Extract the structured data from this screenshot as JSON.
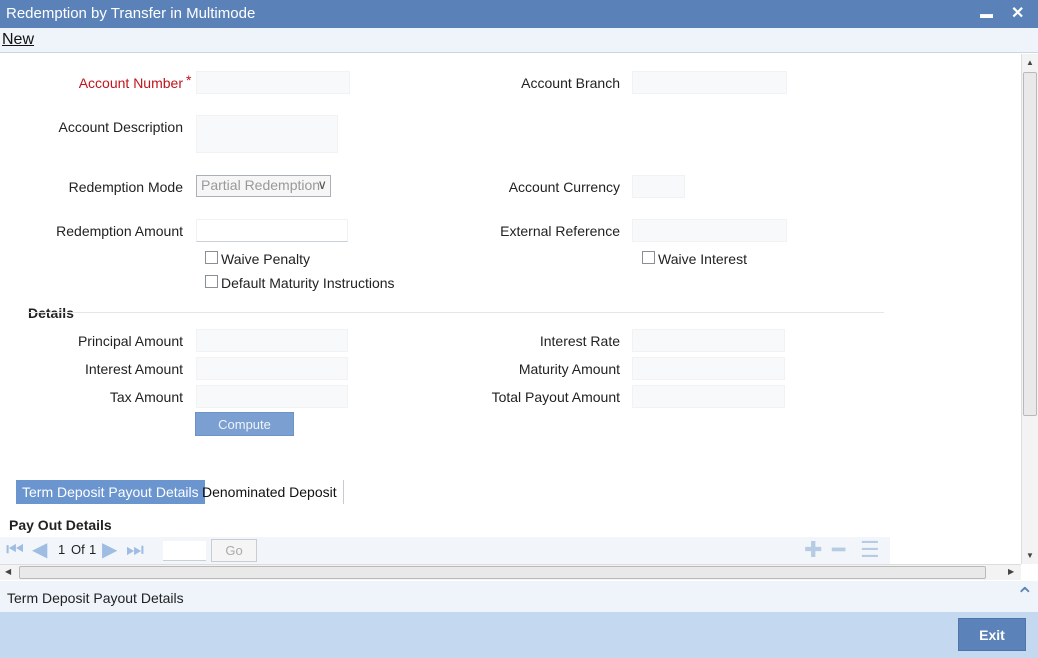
{
  "window": {
    "title": "Redemption by Transfer in Multimode",
    "minimize_glyph": "▬",
    "close_glyph": "✕"
  },
  "menu": {
    "new_label": "New"
  },
  "form": {
    "account_number_label": "Account Number",
    "required_marker": "*",
    "account_number_value": "",
    "account_branch_label": "Account Branch",
    "account_branch_value": "",
    "account_description_label": "Account Description",
    "account_description_value": "",
    "redemption_mode_label": "Redemption Mode",
    "redemption_mode_value": "Partial Redemption",
    "account_currency_label": "Account Currency",
    "account_currency_value": "",
    "redemption_amount_label": "Redemption Amount",
    "redemption_amount_value": "",
    "external_reference_label": "External Reference",
    "external_reference_value": "",
    "waive_penalty_label": "Waive Penalty",
    "waive_penalty_checked": false,
    "default_maturity_label": "Default Maturity Instructions",
    "default_maturity_checked": false,
    "waive_interest_label": "Waive Interest",
    "waive_interest_checked": false
  },
  "details": {
    "section_title": "Details",
    "principal_amount_label": "Principal Amount",
    "interest_amount_label": "Interest Amount",
    "tax_amount_label": "Tax Amount",
    "interest_rate_label": "Interest Rate",
    "maturity_amount_label": "Maturity Amount",
    "total_payout_amount_label": "Total Payout Amount",
    "compute_label": "Compute"
  },
  "tabs": [
    {
      "label": "Term Deposit Payout Details",
      "active": true
    },
    {
      "label": "Denominated Deposit",
      "active": false
    }
  ],
  "payout": {
    "section_title": "Pay Out Details",
    "page_current": "1",
    "page_of": "Of",
    "page_total": "1",
    "go_label": "Go"
  },
  "footer": {
    "status_text": "Term Deposit Payout Details",
    "exit_label": "Exit"
  },
  "colors": {
    "titlebar": "#5b82b8",
    "required": "#c0141c",
    "active_tab": "#6b95cf",
    "footer_bg": "#c4d9ef",
    "exit_button": "#5c83b9"
  }
}
